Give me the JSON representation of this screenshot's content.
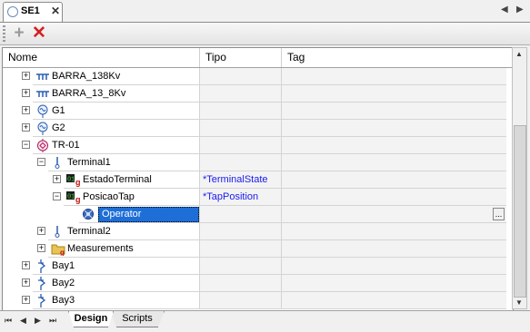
{
  "document_tab": {
    "title": "SE1",
    "close": "✕"
  },
  "tab_nav": {
    "prev": "◀",
    "next": "▶"
  },
  "toolbar": {
    "add": "+",
    "delete": "✕"
  },
  "columns": {
    "name": "Nome",
    "type": "Tipo",
    "tag": "Tag"
  },
  "rows": [
    {
      "label": "BARRA_138Kv",
      "type": "",
      "expander": "+",
      "icon": "busbar-icon"
    },
    {
      "label": "BARRA_13_8Kv",
      "type": "",
      "expander": "+",
      "icon": "busbar-icon"
    },
    {
      "label": "G1",
      "type": "",
      "expander": "+",
      "icon": "generator-icon"
    },
    {
      "label": "G2",
      "type": "",
      "expander": "+",
      "icon": "generator-icon"
    },
    {
      "label": "TR-01",
      "type": "",
      "expander": "−",
      "icon": "transformer-icon"
    },
    {
      "label": "Terminal1",
      "type": "",
      "expander": "−",
      "icon": "terminal-icon"
    },
    {
      "label": "EstadoTerminal",
      "type": "*TerminalState",
      "expander": "+",
      "icon": "data-object-icon"
    },
    {
      "label": "PosicaoTap",
      "type": "*TapPosition",
      "expander": "−",
      "icon": "data-object-icon"
    },
    {
      "label": "Operator",
      "type": "",
      "expander": "",
      "icon": "operator-icon",
      "ellipsis": "..."
    },
    {
      "label": "Terminal2",
      "type": "",
      "expander": "+",
      "icon": "terminal-icon"
    },
    {
      "label": "Measurements",
      "type": "",
      "expander": "+",
      "icon": "folder-icon"
    },
    {
      "label": "Bay1",
      "type": "",
      "expander": "+",
      "icon": "bay-icon"
    },
    {
      "label": "Bay2",
      "type": "",
      "expander": "+",
      "icon": "bay-icon"
    },
    {
      "label": "Bay3",
      "type": "",
      "expander": "+",
      "icon": "bay-icon"
    }
  ],
  "bottom_nav": {
    "first": "⏮",
    "prev": "◀",
    "next": "▶",
    "last": "⏭"
  },
  "bottom_tabs": {
    "design": "Design",
    "scripts": "Scripts"
  },
  "colors": {
    "selection": "#1e6ed7",
    "type_text": "#1a1aee",
    "delete": "#d42020"
  }
}
